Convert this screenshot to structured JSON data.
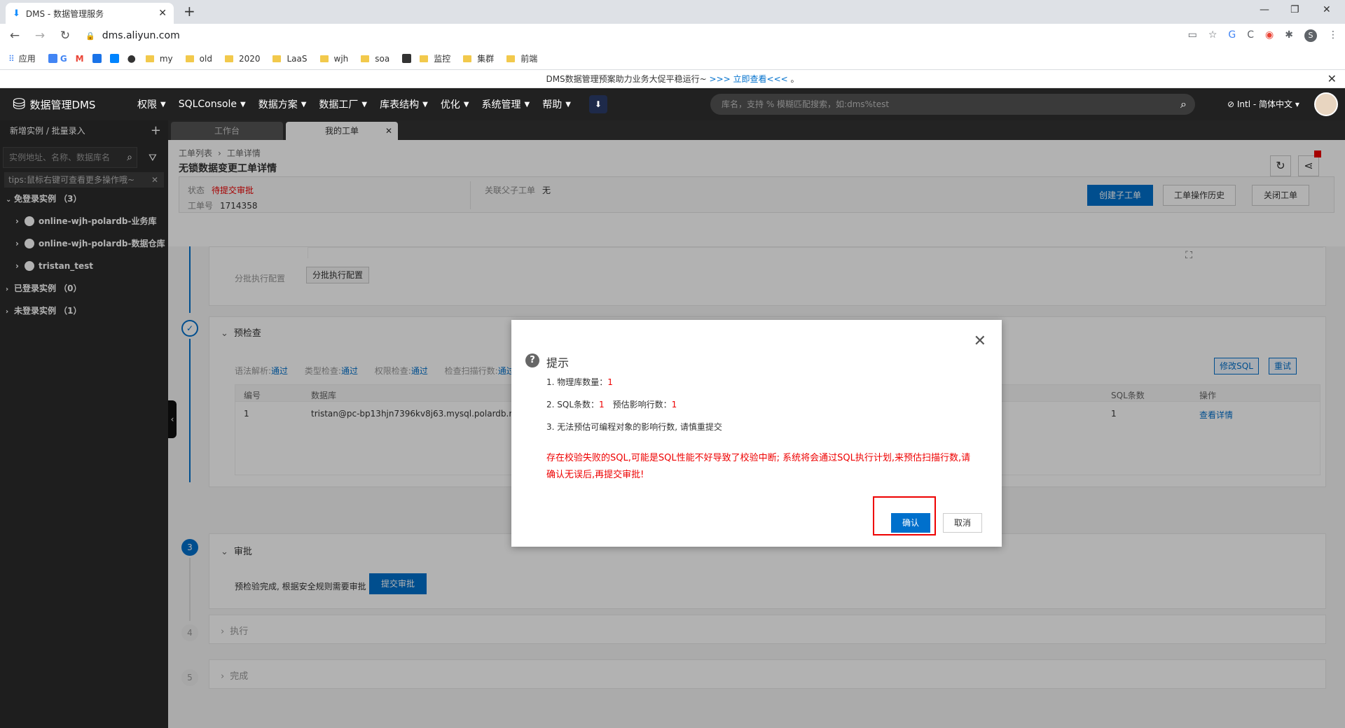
{
  "browser": {
    "tab_title": "DMS - 数据管理服务",
    "url": "dms.aliyun.com",
    "profile_initial": "S",
    "bookmarks": [
      "应用",
      "my",
      "old",
      "2020",
      "LaaS",
      "wjh",
      "soa",
      "监控",
      "集群",
      "前端"
    ]
  },
  "announcement": {
    "text": "DMS数据管理预案助力业务大促平稳运行~ ",
    "link": ">>> 立即查看<<<",
    "tail": " 。"
  },
  "topnav": {
    "logo": "数据管理DMS",
    "menus": [
      "权限",
      "SQLConsole",
      "数据方案",
      "数据工厂",
      "库表结构",
      "优化",
      "系统管理",
      "帮助"
    ],
    "search_placeholder": "库名，支持 % 模糊匹配搜索，如:dms%test",
    "lang": "Intl - 简体中文"
  },
  "sidebar": {
    "header": "新增实例 / 批量录入",
    "search_placeholder": "实例地址、名称、数据库名",
    "tips": "tips:鼠标右键可查看更多操作哦~",
    "group_free": "免登录实例 （3）",
    "instances": [
      "online-wjh-polardb-业务库",
      "online-wjh-polardb-数据仓库",
      "tristan_test"
    ],
    "group_logged": "已登录实例 （0）",
    "group_unlogged": "未登录实例 （1）"
  },
  "main": {
    "tabs": [
      "工作台",
      "我的工单"
    ],
    "breadcrumb": [
      "工单列表",
      "工单详情"
    ],
    "title": "无锁数据变更工单详情",
    "status_label": "状态",
    "status_value": "待提交审批",
    "order_label": "工单号",
    "order_value": "1714358",
    "related_label": "关联父子工单",
    "related_value": "无",
    "btn_create_child": "创建子工单",
    "btn_history": "工单操作历史",
    "btn_close": "关闭工单",
    "batch_label": "分批执行配置",
    "batch_btn": "分批执行配置",
    "precheck_title": "预检查",
    "checks": [
      {
        "label": "语法解析:",
        "value": "通过"
      },
      {
        "label": "类型检查:",
        "value": "通过"
      },
      {
        "label": "权限检查:",
        "value": "通过"
      },
      {
        "label": "检查扫描行数:",
        "value": "通过"
      }
    ],
    "btn_modify_sql": "修改SQL",
    "btn_retry": "重试",
    "table": {
      "headers": [
        "编号",
        "数据库",
        "SQL条数",
        "操作"
      ],
      "row": [
        "1",
        "tristan@pc-bp13hjn7396kv8j63.mysql.polardb.rds.aliyuncs.com",
        "1",
        "查看详情"
      ]
    },
    "step3_no": "3",
    "approve_title": "审批",
    "approve_text": "预检验完成, 根据安全规则需要审批",
    "btn_submit": "提交审批",
    "step4_no": "4",
    "exec_title": "执行",
    "step5_no": "5",
    "done_title": "完成"
  },
  "dialog": {
    "title": "提示",
    "line1_label": "1. 物理库数量：",
    "line1_value": "1",
    "line2_label": "2. SQL条数：",
    "line2_value": "1",
    "line2b_label": "预估影响行数：",
    "line2b_value": "1",
    "line3": "3. 无法预估可编程对象的影响行数, 请慎重提交",
    "warning": "存在校验失败的SQL,可能是SQL性能不好导致了校验中断; 系统将会通过SQL执行计划,来预估扫描行数,请确认无误后,再提交审批!",
    "confirm": "确认",
    "cancel": "取消"
  },
  "colors": {
    "accent": "#0070cc",
    "danger": "#e00000",
    "nav_bg": "#212121",
    "sidebar_bg": "#2b2b2b"
  }
}
